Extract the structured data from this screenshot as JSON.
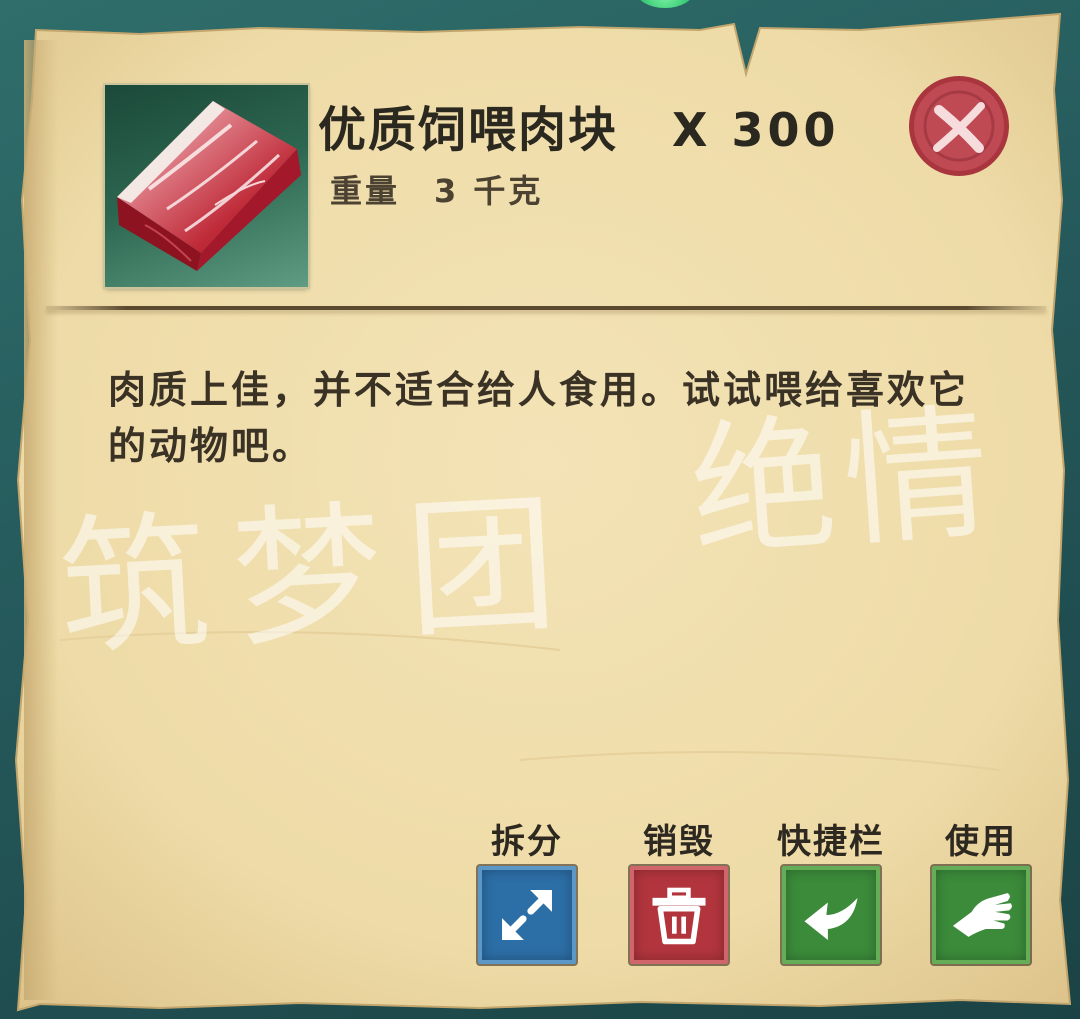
{
  "item": {
    "name": "优质饲喂肉块",
    "quantity": "X 300",
    "weight_label": "重量",
    "weight_value": "3 千克",
    "description": "肉质上佳，并不适合给人食用。试试喂给喜欢它的动物吧。",
    "icon": "raw-prime-meat-icon"
  },
  "close_button": {
    "icon": "close-seal-icon",
    "color": "#c04a54"
  },
  "actions": [
    {
      "label": "拆分",
      "icon": "split-arrows-icon",
      "color": "#2c6ea6",
      "border": "#5b98c7"
    },
    {
      "label": "销毁",
      "icon": "trash-icon",
      "color": "#b2353d",
      "border": "#d0656c"
    },
    {
      "label": "快捷栏",
      "icon": "hotbar-arrow-icon",
      "color": "#3b8b3a",
      "border": "#66ad58"
    },
    {
      "label": "使用",
      "icon": "hand-icon",
      "color": "#3b8b3a",
      "border": "#66ad58"
    }
  ],
  "watermark": [
    "筑梦团",
    "绝情"
  ],
  "colors": {
    "background": "#25595b",
    "parchment": "#eedba7",
    "text": "#2b281f"
  }
}
